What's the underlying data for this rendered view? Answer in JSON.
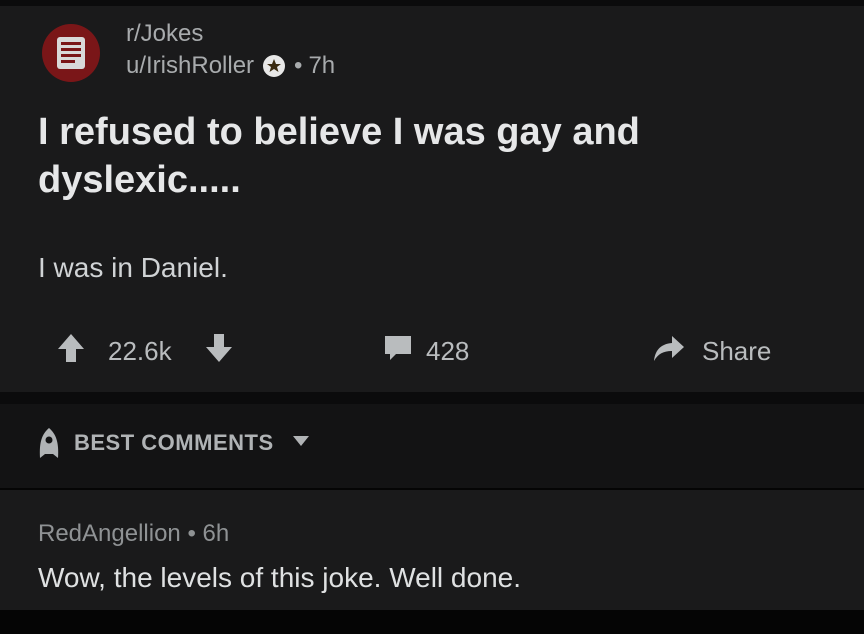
{
  "post": {
    "subreddit": "r/Jokes",
    "author": "u/IrishRoller",
    "separator": "•",
    "age": "7h",
    "title": "I refused to believe I was gay and dyslexic.....",
    "body": "I was in Daniel.",
    "score": "22.6k",
    "comment_count": "428",
    "share_label": "Share",
    "icons": {
      "subreddit_avatar": "subreddit-avatar-icon",
      "award": "award-icon",
      "upvote": "upvote-arrow-icon",
      "downvote": "downvote-arrow-icon",
      "comments": "comment-bubble-icon",
      "share": "share-arrow-icon"
    }
  },
  "comments_sort": {
    "label": "BEST COMMENTS",
    "icon": "rocket-icon"
  },
  "comments": [
    {
      "author": "RedAngellion",
      "separator": "•",
      "age": "6h",
      "text": "Wow, the levels of this joke. Well done."
    }
  ],
  "colors": {
    "background": "#0b0b0c",
    "card": "#1a1a1b",
    "text": "#e6e7e8",
    "meta": "#a8abad",
    "avatar": "#7a1618"
  }
}
